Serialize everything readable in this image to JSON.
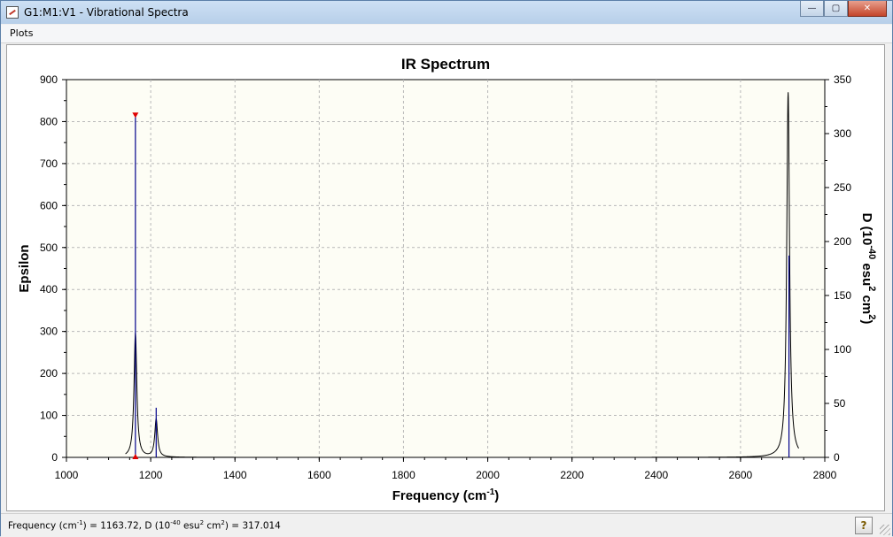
{
  "window": {
    "title": "G1:M1:V1 - Vibrational Spectra",
    "minimize_glyph": "—",
    "maximize_glyph": "▢",
    "close_glyph": "✕"
  },
  "menu": {
    "plots_label": "Plots"
  },
  "status": {
    "freq_prefix": "Frequency (cm",
    "freq_sup": "-1",
    "freq_mid": ") = 1163.72, D (10",
    "d_sup": "-40",
    "d_mid": " esu",
    "esu_sup": "2",
    "d_mid2": " cm",
    "cm_sup": "2",
    "d_value": ") = 317.014",
    "help_glyph": "?"
  },
  "chart_data": {
    "type": "line",
    "title": "IR Spectrum",
    "xlabel": "Frequency (cm-1)",
    "xlabel_base": "Frequency (cm",
    "xlabel_sup": "-1",
    "xlabel_tail": ")",
    "ylabel": "Epsilon",
    "y2label": "D (10-40 esu2 cm2)",
    "y2label_parts": [
      "D (10",
      "-40",
      " esu",
      "2",
      " cm",
      "2",
      ")"
    ],
    "xlim": [
      1000,
      2800
    ],
    "ylim": [
      0,
      900
    ],
    "y2lim": [
      0,
      350
    ],
    "x_ticks": [
      1000,
      1200,
      1400,
      1600,
      1800,
      2000,
      2200,
      2400,
      2600,
      2800
    ],
    "y_ticks": [
      0,
      100,
      200,
      300,
      400,
      500,
      600,
      700,
      800,
      900
    ],
    "y2_ticks": [
      0,
      50,
      100,
      150,
      200,
      250,
      300,
      350
    ],
    "grid": true,
    "epsilon_peaks": [
      {
        "freq": 1163.72,
        "epsilon": 295,
        "width": 8
      },
      {
        "freq": 1213,
        "epsilon": 90,
        "width": 8
      },
      {
        "freq": 2713,
        "epsilon": 870,
        "width": 8
      }
    ],
    "stick_intensities": [
      {
        "freq": 1163.72,
        "D": 317.014
      },
      {
        "freq": 1213,
        "D": 46
      },
      {
        "freq": 2715,
        "D": 187
      }
    ],
    "selected_peak": {
      "freq": 1163.72,
      "D": 317.014
    },
    "colors": {
      "spectrum": "#000000",
      "sticks": "#00008b",
      "marker": "#e00000",
      "plot_bg": "#fdfdf5",
      "grid": "#b8b8b8"
    }
  }
}
